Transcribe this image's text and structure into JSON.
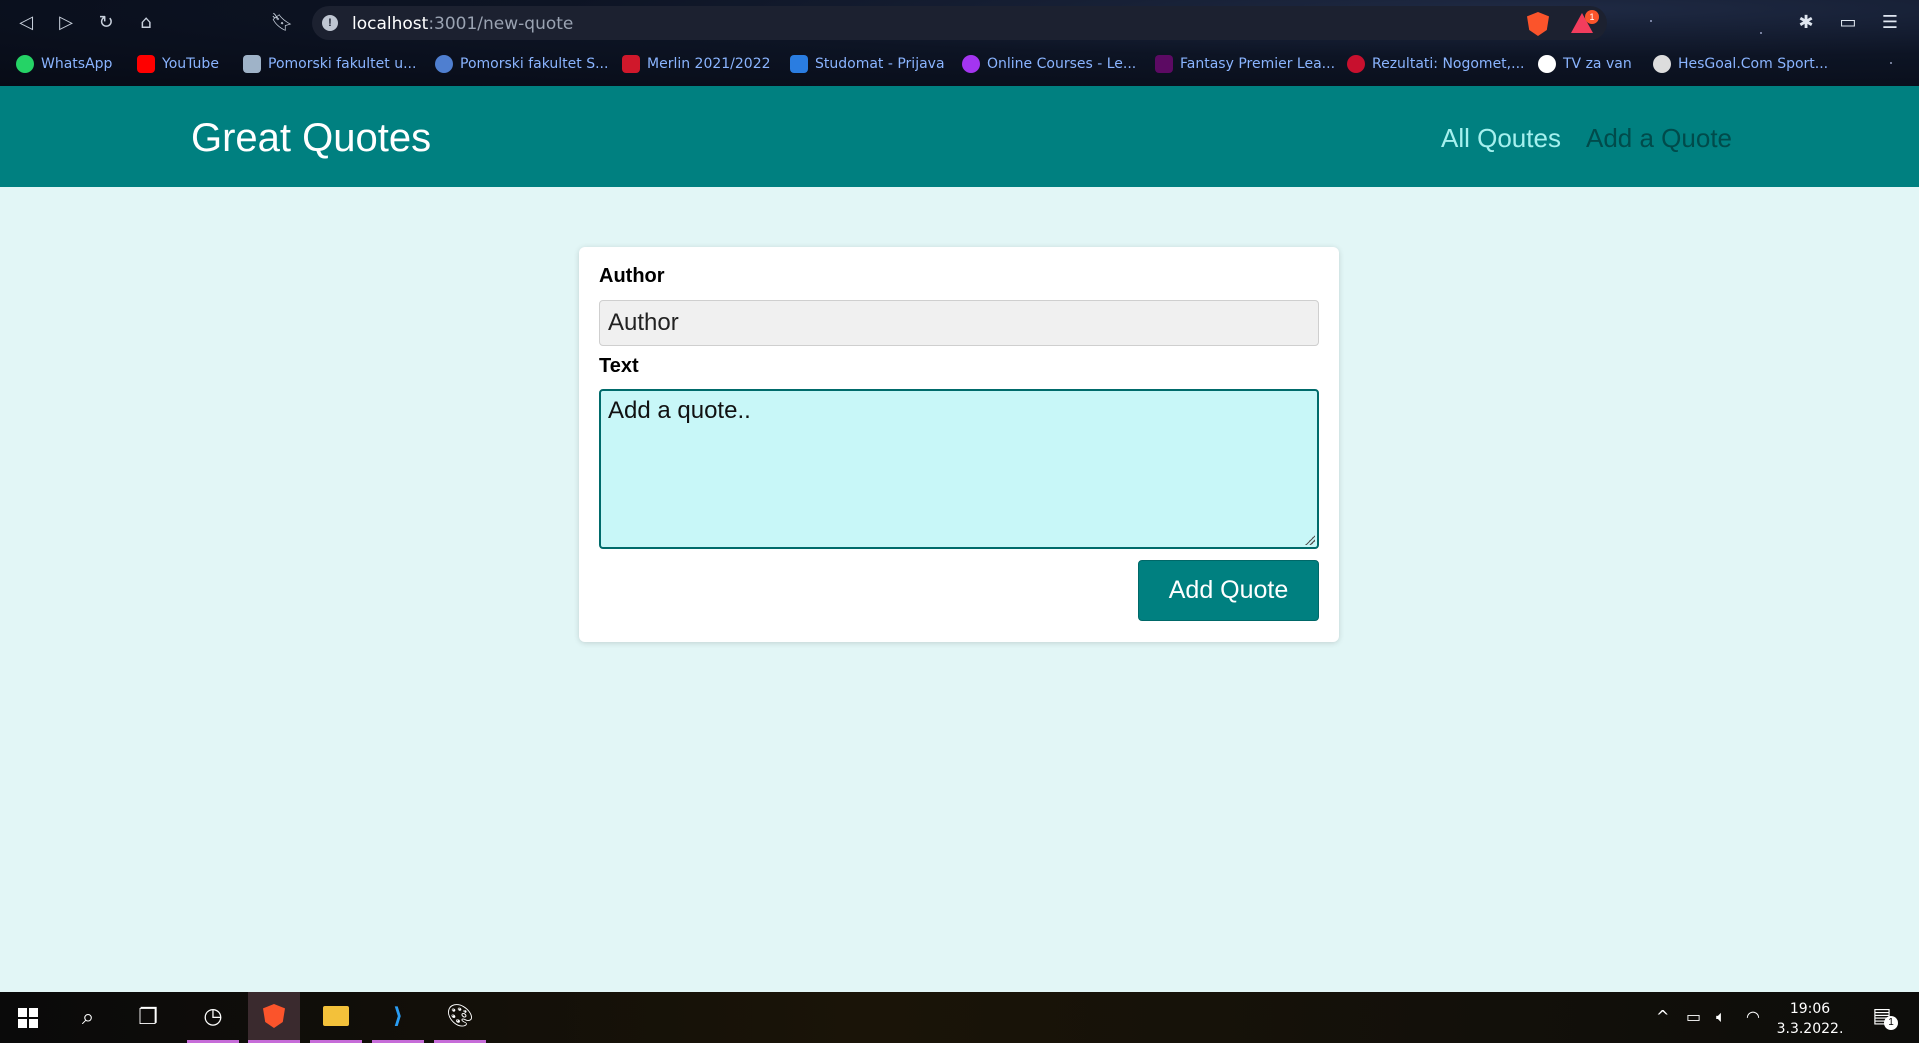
{
  "browser": {
    "url_host": "localhost",
    "url_path": ":3001/new-quote",
    "rewards_badge": "1",
    "bookmarks": [
      {
        "label": "WhatsApp",
        "icon": "whatsapp-icon",
        "color": "#25d366"
      },
      {
        "label": "YouTube",
        "icon": "youtube-icon",
        "color": "#ff0000"
      },
      {
        "label": "Pomorski fakultet u...",
        "icon": "faculty-icon",
        "color": "#9fb3c8"
      },
      {
        "label": "Pomorski fakultet S...",
        "icon": "faculty-s-icon",
        "color": "#4f7fd0"
      },
      {
        "label": "Merlin 2021/2022",
        "icon": "merlin-icon",
        "color": "#d0182b"
      },
      {
        "label": "Studomat - Prijava",
        "icon": "studomat-icon",
        "color": "#2a7de1"
      },
      {
        "label": "Online Courses - Le...",
        "icon": "udemy-icon",
        "color": "#a435f0"
      },
      {
        "label": "Fantasy Premier Lea...",
        "icon": "premier-league-icon",
        "color": "#5c0a63"
      },
      {
        "label": "Rezultati: Nogomet,...",
        "icon": "rezultati-icon",
        "color": "#c8102e"
      },
      {
        "label": "TV za van",
        "icon": "globe-icon",
        "color": "#ffffff"
      },
      {
        "label": "HesGoal.Com Sport...",
        "icon": "football-icon",
        "color": "#dddddd"
      }
    ]
  },
  "app": {
    "brand": "Great Quotes",
    "nav": {
      "all_quotes": "All Qoutes",
      "add_quote": "Add a Quote"
    },
    "colors": {
      "primary": "#008080",
      "background": "#e2f6f6"
    }
  },
  "form": {
    "author_label": "Author",
    "author_placeholder": "Author",
    "author_value": "",
    "text_label": "Text",
    "text_value": "Add a quote..",
    "submit_label": "Add Quote"
  },
  "taskbar": {
    "time": "19:06",
    "date": "3.3.2022.",
    "notification_count": "1"
  }
}
